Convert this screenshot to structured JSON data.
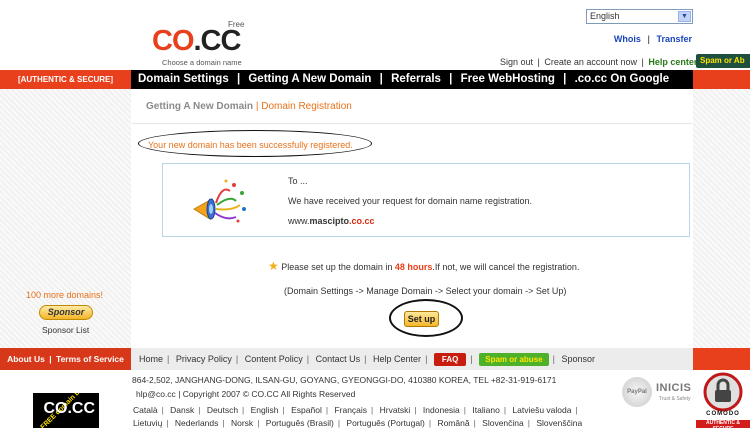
{
  "header": {
    "logo_free": "Free",
    "logo_text": "CO.CC",
    "logo_tagline": "Choose a domain name",
    "language_selected": "English",
    "link_whois": "Whois",
    "link_transfer": "Transfer",
    "sign_out": "Sign out",
    "create_account": "Create an account now",
    "help_center": "Help center",
    "spam_badge": "Spam or Ab"
  },
  "navbar": {
    "left_label": "[AUTHENTIC & SECURE]",
    "items": [
      "Domain Settings",
      "Getting A New Domain",
      "Referrals",
      "Free WebHosting",
      ".co.cc On Google"
    ]
  },
  "breadcrumb": {
    "parent": "Getting A New Domain",
    "separator": "|",
    "current": "Domain Registration"
  },
  "main": {
    "success_message": "Your new domain has been successfully registered.",
    "card": {
      "to": "To ...",
      "received": "We have received your request for domain name registration.",
      "domain_prefix": "www.",
      "domain_name": "mascipto",
      "domain_suffix": ".co.cc"
    },
    "instruction_before": "Please set up the domain in ",
    "instruction_hours": "48 hours",
    "instruction_after": ".If not, we will cancel the registration.",
    "path_hint": "(Domain Settings -> Manage Domain -> Select your domain -> Set Up)",
    "setup_button": "Set up"
  },
  "sidebar": {
    "more_domains": "100 more domains!",
    "sponsor_button": "Sponsor",
    "sponsor_list": "Sponsor List"
  },
  "footer": {
    "about": "About Us",
    "terms": "Terms of Service",
    "links": {
      "home": "Home",
      "privacy": "Privacy Policy",
      "content": "Content Policy",
      "contact": "Contact Us",
      "help": "Help Center",
      "faq": "FAQ",
      "spam": "Spam or abuse",
      "sponsor": "Sponsor"
    },
    "address": "864-2,502, JANGHANG-DONG, ILSAN-GU, GOYANG, GYEONGGI-DO, 410380 KOREA, TEL +82-31-919-6171",
    "email": "hlp@co.cc",
    "copyright": "Copyright 2007 © CO.CC All Rights Reserved",
    "languages_row1": [
      "Català",
      "Dansk",
      "Deutsch",
      "English",
      "Español",
      "Français",
      "Hrvatski",
      "Indonesia",
      "Italiano",
      "Latviešu valoda"
    ],
    "languages_row2": [
      "Lietuvių",
      "Nederlands",
      "Norsk",
      "Português (Brasil)",
      "Português (Portugal)",
      "Română",
      "Slovenčina",
      "Slovenščina"
    ],
    "banner_text": "FREE domain DNS",
    "banner_logo": "CO.CC",
    "badge_paypal": "PayPal",
    "badge_inicis": "INICIS",
    "badge_inicis_sub": "Trust & Safety",
    "badge_comodo": "COMODO",
    "badge_comodo_sub": "AUTHENTIC & SECURE"
  },
  "colors": {
    "brand_orange": "#e8401c",
    "link_blue": "#1947b8",
    "highlight_orange": "#e8721a",
    "help_green": "#2a7a1a"
  }
}
